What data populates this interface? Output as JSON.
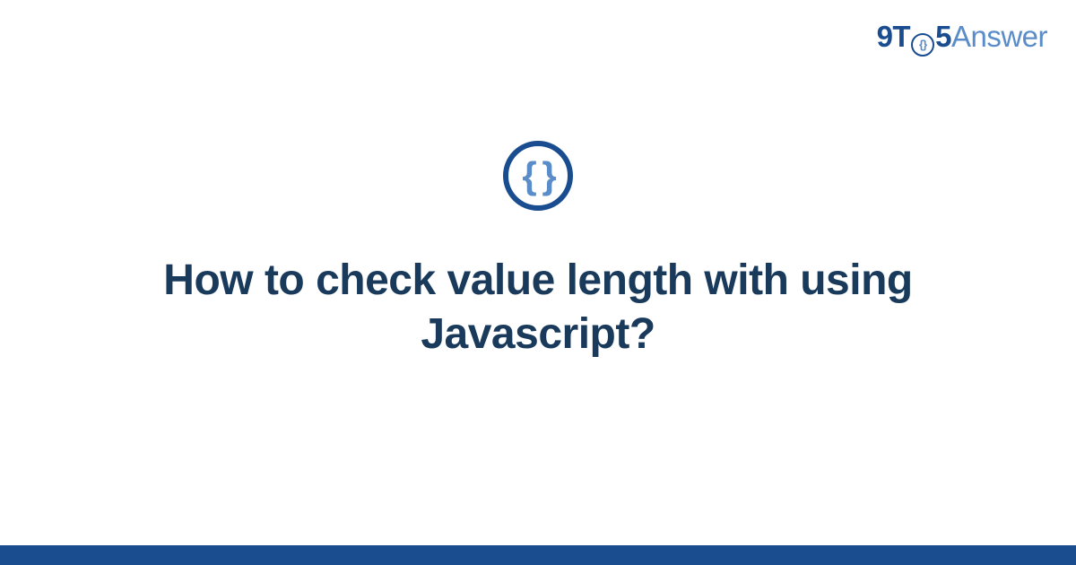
{
  "logo": {
    "part1": "9T",
    "braces": "{}",
    "part2": "5",
    "part3": "Answer"
  },
  "main": {
    "icon_braces": "{ }",
    "title": "How to check value length with using Javascript?"
  }
}
